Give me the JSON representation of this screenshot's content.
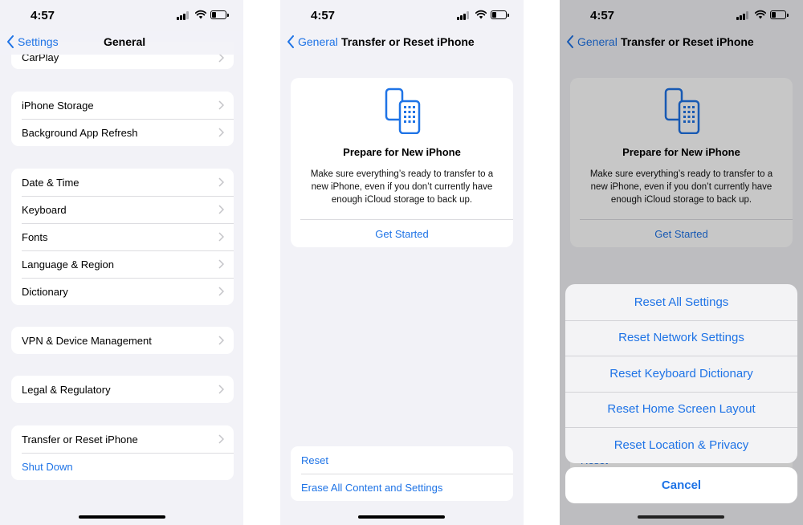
{
  "status": {
    "time": "4:57"
  },
  "screen1": {
    "back_label": "Settings",
    "title": "General",
    "cut_row": "CarPlay",
    "group1": [
      "iPhone Storage",
      "Background App Refresh"
    ],
    "group2": [
      "Date & Time",
      "Keyboard",
      "Fonts",
      "Language & Region",
      "Dictionary"
    ],
    "group3": [
      "VPN & Device Management"
    ],
    "group4": [
      "Legal & Regulatory"
    ],
    "group5": {
      "transfer": "Transfer or Reset iPhone",
      "shutdown": "Shut Down"
    }
  },
  "screen2": {
    "back_label": "General",
    "title": "Transfer or Reset iPhone",
    "card": {
      "title": "Prepare for New iPhone",
      "desc": "Make sure everything’s ready to transfer to a new iPhone, even if you don’t currently have enough iCloud storage to back up.",
      "button": "Get Started"
    },
    "reset": "Reset",
    "erase": "Erase All Content and Settings"
  },
  "screen3": {
    "back_label": "General",
    "title": "Transfer or Reset iPhone",
    "card": {
      "title": "Prepare for New iPhone",
      "desc": "Make sure everything’s ready to transfer to a new iPhone, even if you don’t currently have enough iCloud storage to back up.",
      "button": "Get Started"
    },
    "hidden_reset": "Reset",
    "actions": [
      "Reset All Settings",
      "Reset Network Settings",
      "Reset Keyboard Dictionary",
      "Reset Home Screen Layout",
      "Reset Location & Privacy"
    ],
    "cancel": "Cancel"
  },
  "colors": {
    "accent": "#1e73e6",
    "background": "#f2f2f7"
  },
  "icons": [
    "back-chevron-icon",
    "chevron-right-icon",
    "cellular-signal-icon",
    "wifi-icon",
    "battery-icon",
    "transfer-phones-icon"
  ]
}
